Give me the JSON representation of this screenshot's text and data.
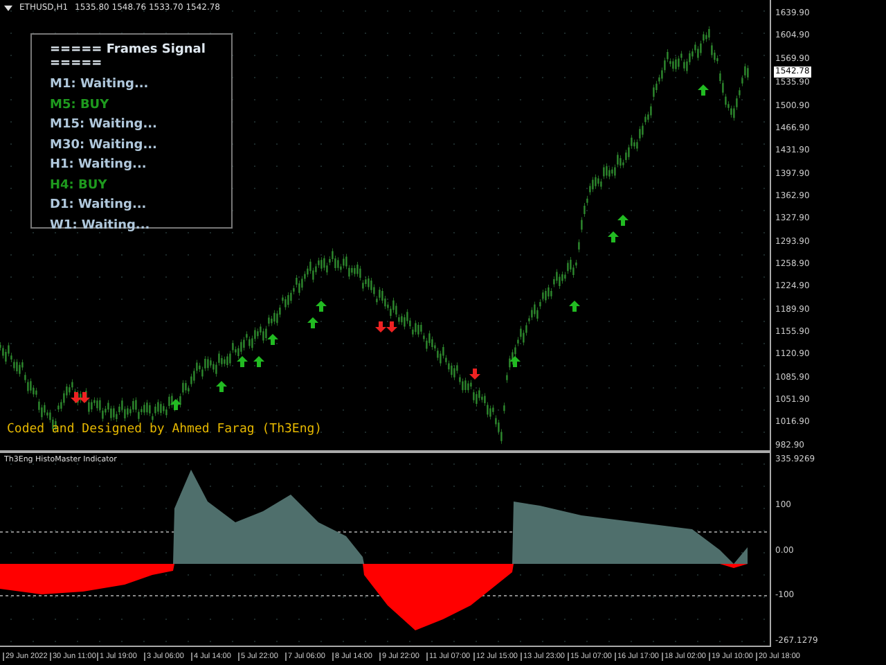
{
  "chart": {
    "quote": "1535.80 1548.76 1533.70 1542.78",
    "symbol": "ETHUSD,H1",
    "price_ticks": [
      "1639.90",
      "1604.90",
      "1569.90",
      "1535.90",
      "1500.90",
      "1466.90",
      "1431.90",
      "1397.90",
      "1362.90",
      "1327.90",
      "1293.90",
      "1258.90",
      "1224.90",
      "1189.90",
      "1155.90",
      "1120.90",
      "1085.90",
      "1051.90",
      "1016.90",
      "982.90"
    ],
    "current_price": "1542.78",
    "signal_panel": {
      "title": "===== Frames Signal =====",
      "rows": [
        {
          "text": "M1: Waiting...",
          "kind": "waiting"
        },
        {
          "text": "M5: BUY",
          "kind": "buy"
        },
        {
          "text": "M15: Waiting...",
          "kind": "waiting"
        },
        {
          "text": "M30: Waiting...",
          "kind": "waiting"
        },
        {
          "text": "H1: Waiting...",
          "kind": "waiting"
        },
        {
          "text": "H4: BUY",
          "kind": "buy"
        },
        {
          "text": "D1: Waiting...",
          "kind": "waiting"
        },
        {
          "text": "W1: Waiting...",
          "kind": "waiting"
        }
      ]
    },
    "credit": "Coded and Designed by Ahmed Farag (Th3Eng)"
  },
  "indicator": {
    "title": "Th3Eng HistoMaster Indicator",
    "ticks": [
      "335.9269",
      "100",
      "0.00",
      "-100",
      "-267.1279"
    ]
  },
  "time_axis": [
    "29 Jun 2022",
    "30 Jun 11:00",
    "1 Jul 19:00",
    "3 Jul 06:00",
    "4 Jul 14:00",
    "5 Jul 22:00",
    "7 Jul 06:00",
    "8 Jul 14:00",
    "9 Jul 22:00",
    "11 Jul 07:00",
    "12 Jul 15:00",
    "13 Jul 23:00",
    "15 Jul 07:00",
    "16 Jul 17:00",
    "18 Jul 02:00",
    "19 Jul 10:00",
    "20 Jul 18:00"
  ]
}
